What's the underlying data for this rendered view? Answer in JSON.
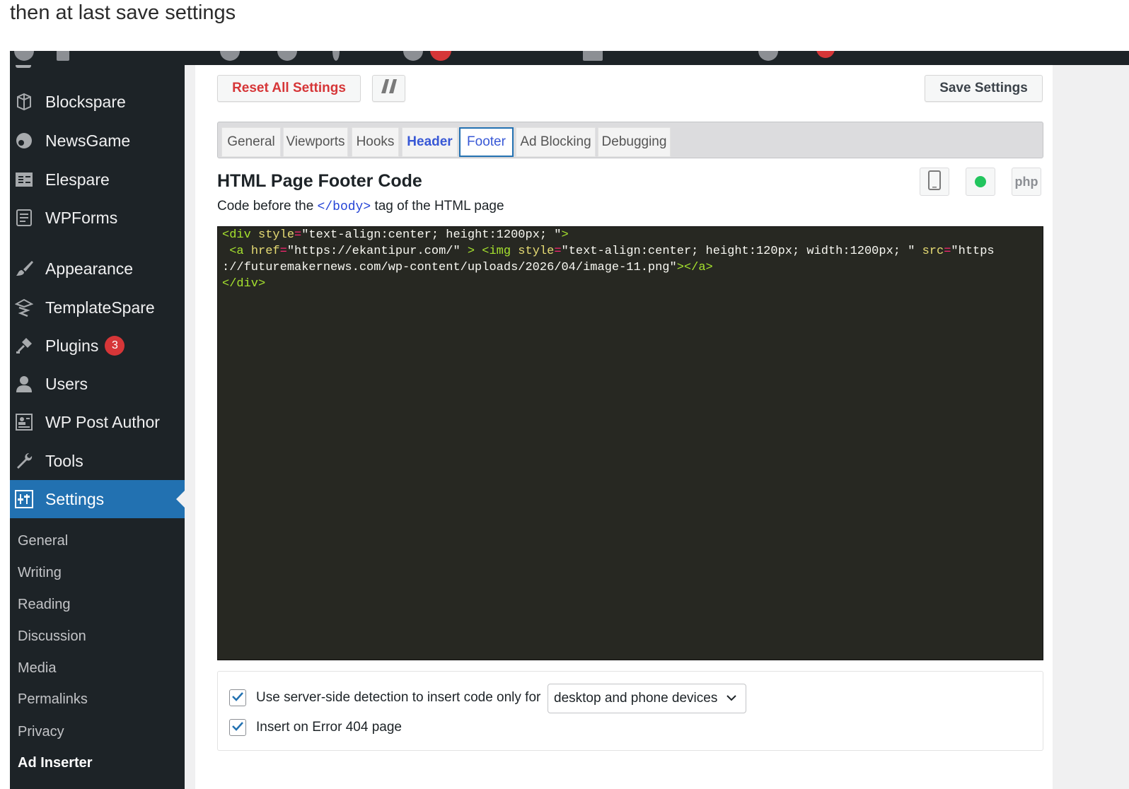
{
  "caption": "then at last save settings",
  "sidebar": {
    "top_items": [
      {
        "label": "Blockspare",
        "icon": "blockspare-icon"
      },
      {
        "label": "NewsGame",
        "icon": "newsgame-icon"
      },
      {
        "label": "Elespare",
        "icon": "elespare-icon"
      },
      {
        "label": "WPForms",
        "icon": "wpforms-icon"
      },
      {
        "label": "Appearance",
        "icon": "paintbrush-icon"
      },
      {
        "label": "TemplateSpare",
        "icon": "templatespare-icon"
      },
      {
        "label": "Plugins",
        "icon": "plugin-icon",
        "badge": "3"
      },
      {
        "label": "Users",
        "icon": "users-icon"
      },
      {
        "label": "WP Post Author",
        "icon": "post-author-icon"
      },
      {
        "label": "Tools",
        "icon": "wrench-icon"
      },
      {
        "label": "Settings",
        "icon": "settings-icon",
        "active": true
      }
    ],
    "sub_items": [
      {
        "label": "General"
      },
      {
        "label": "Writing"
      },
      {
        "label": "Reading"
      },
      {
        "label": "Discussion"
      },
      {
        "label": "Media"
      },
      {
        "label": "Permalinks"
      },
      {
        "label": "Privacy"
      },
      {
        "label": "Ad Inserter",
        "current": true
      }
    ]
  },
  "toolbar": {
    "reset_label": "Reset All Settings",
    "save_label": "Save Settings"
  },
  "tabs": [
    {
      "label": "General"
    },
    {
      "label": "Viewports"
    },
    {
      "label": "Hooks"
    },
    {
      "label": "Header"
    },
    {
      "label": "Footer",
      "selected": true
    },
    {
      "label": "Ad Blocking"
    },
    {
      "label": "Debugging"
    }
  ],
  "section": {
    "title": "HTML Page Footer Code",
    "subtitle_before": "Code before the",
    "subtitle_code": "</body>",
    "subtitle_after": "tag of the HTML page",
    "php_label": "php"
  },
  "code": {
    "line1": {
      "open": "<div",
      "attr": "style",
      "value": "\"text-align:center; height:1200px; \"",
      "close": ">"
    },
    "line2": {
      "a_open": "<a",
      "href_attr": "href",
      "href_value": "\"https://ekantipur.com/\"",
      "img_open": "<img",
      "style_attr": "style",
      "style_value": "\"text-align:center; height:120px; width:1200px; \"",
      "src_attr": "src",
      "src_value_start": "\"https"
    },
    "line3": {
      "src_value_rest": "://futuremakernews.com/wp-content/uploads/2026/04/image-11.png\"",
      "close": "></a>"
    },
    "line4": {
      "close": "</div>"
    }
  },
  "options": {
    "server_side_label": "Use server-side detection to insert code only for",
    "server_side_checked": true,
    "device_select_value": "desktop and phone devices",
    "error404_label": "Insert on Error 404 page",
    "error404_checked": true
  },
  "colors": {
    "sidebar_bg": "#1d2327",
    "active_blue": "#2271b1",
    "reset_red": "#d63638",
    "status_green": "#22c55e"
  }
}
